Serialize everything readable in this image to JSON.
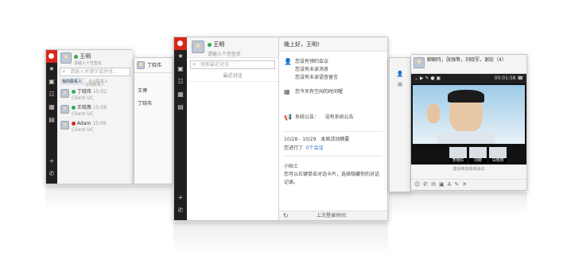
{
  "left_window": {
    "me_name": "王明",
    "me_signature": "请输入个性签名",
    "search_placeholder": "请输入关键字或拼音...",
    "tabs": [
      "我的联系人",
      "企业联系人"
    ],
    "group_label": "在线联系人",
    "contacts": [
      {
        "name": "丁晓伟",
        "status_text": "Client UC",
        "time": "15:02"
      },
      {
        "name": "王晓燕",
        "status_text": "Client UC",
        "time": "15:08"
      },
      {
        "name": "Adam",
        "status_text": "Client UC",
        "time": "15:09"
      }
    ]
  },
  "chat_preview": {
    "name": "丁晓伟",
    "lines": [
      "王博",
      "丁晓伟"
    ]
  },
  "main_window": {
    "me_name": "王明",
    "me_signature": "请输入个性签名",
    "search_placeholder": "搜索最近对话",
    "recent_label": "最近对话",
    "greeting": "晚上好，王明!",
    "notices": [
      "您没有预约会议",
      "您没有未读消息",
      "您没有未读语音留言"
    ],
    "schedule": "您今天有空闲的时间喔",
    "announce_label": "系统公告：",
    "announce_value": "没有系统公告",
    "weekly_range": "10/28 - 10/29",
    "weekly_label": "本周活动摘要",
    "weekly_text": "您进行了",
    "weekly_count": "0个会话",
    "tip_title": "小贴士",
    "tip_text": "您可以右键单击对话卡片，选择隐藏你的对话记录。",
    "status_bar": "上次登录时间："
  },
  "video_window": {
    "members": "聊聊阵，张强等，刘晓军，谢宏（4）",
    "timer": "00:01:58",
    "thumbs": [
      "李晓红",
      "刘晓",
      "马晓燕"
    ],
    "caption": "邀请参加视频会议"
  },
  "colors": {
    "brand": "#d8281e",
    "rail": "#1f1f1f",
    "online": "#34a853"
  }
}
